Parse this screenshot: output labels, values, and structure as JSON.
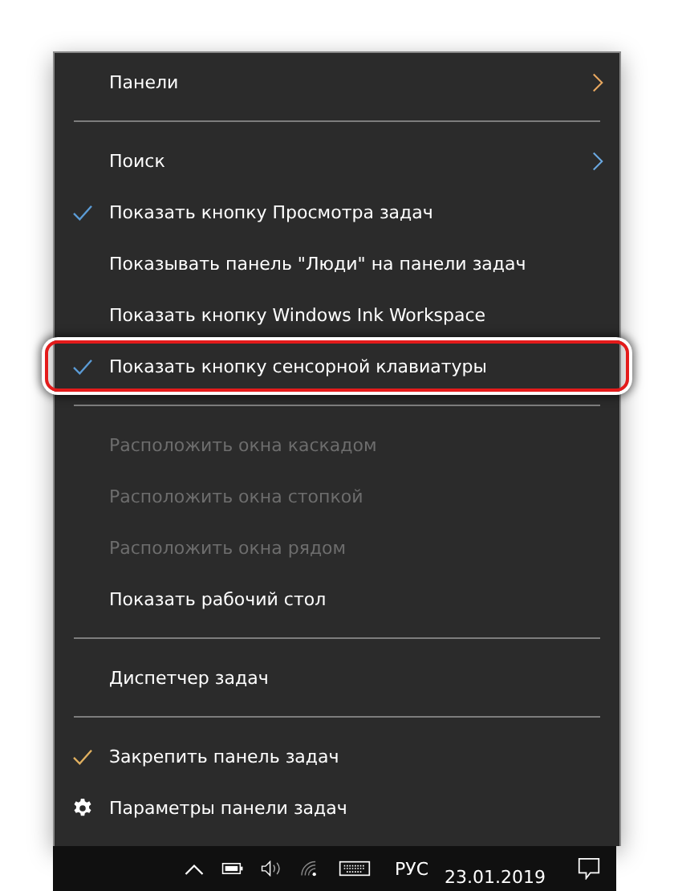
{
  "menu": {
    "items": [
      {
        "kind": "submenu",
        "label": "Панели",
        "color": "#e8a860"
      },
      {
        "kind": "separator"
      },
      {
        "kind": "submenu",
        "label": "Поиск",
        "color": "#6aa8e0"
      },
      {
        "kind": "item",
        "label": "Показать кнопку Просмотра задач",
        "checked": true,
        "color": "#5b9bd5"
      },
      {
        "kind": "item",
        "label": "Показывать панель \"Люди\" на панели задач",
        "checked": false
      },
      {
        "kind": "item",
        "label": "Показать кнопку Windows Ink Workspace",
        "checked": false
      },
      {
        "kind": "item",
        "label": "Показать кнопку сенсорной клавиатуры",
        "checked": true,
        "color": "#5b9bd5",
        "highlighted": true
      },
      {
        "kind": "separator"
      },
      {
        "kind": "item",
        "label": "Расположить окна каскадом",
        "disabled": true
      },
      {
        "kind": "item",
        "label": "Расположить окна стопкой",
        "disabled": true
      },
      {
        "kind": "item",
        "label": "Расположить окна рядом",
        "disabled": true
      },
      {
        "kind": "item",
        "label": "Показать рабочий стол",
        "disabled": false
      },
      {
        "kind": "separator"
      },
      {
        "kind": "item",
        "label": "Диспетчер задач"
      },
      {
        "kind": "separator"
      },
      {
        "kind": "item",
        "label": "Закрепить панель задач",
        "checked": true,
        "color": "#e0b060"
      },
      {
        "kind": "settings",
        "label": "Параметры панели задач"
      }
    ]
  },
  "taskbar": {
    "language": "РУС",
    "date": "23.01.2019"
  }
}
